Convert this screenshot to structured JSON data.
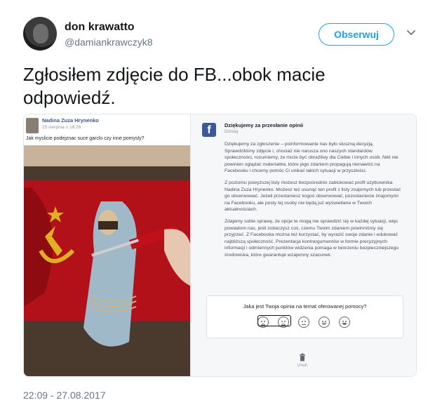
{
  "user": {
    "name": "don krawatto",
    "handle": "@damiankrawczyk8",
    "follow_label": "Obserwuj"
  },
  "tweet": {
    "text_line1": "Zgłosiłem zdjęcie do FB...obok macie",
    "text_line2": "odpowiedź.",
    "timestamp": "22:09 - 27.08.2017"
  },
  "fb_post": {
    "author": "Nadina Zuza Hrynenko",
    "date": "25 sierpnia o 16:26",
    "text": "Jak myslicie podejznac suce garclo czy inne pomysly?"
  },
  "fb_panel": {
    "logo": "f",
    "title": "Dziękujemy za przesłanie opinii",
    "subtitle": "Dzisiaj",
    "paragraph1": "Dziękujemy za zgłoszenie – poinformowanie nas było słuszną decyzją. Sprawdziliśmy zdjęcie i, chociaż nie narusza ono naszych standardów społeczności, rozumiemy, że może być obraźliwy dla Ciebie i innych osób. Nikt nie powinien oglądać materiałów, które jego zdaniem propagują nienawiść na Facebooku i chcemy pomóc Ci unikać takich sytuacji w przyszłości.",
    "paragraph2": "Z poziomu powyższej listy możesz bezpośrednio zablokować profil użytkownika Nadina Zuza Hrynenko. Możesz też usunąć ten profil z listy znajomych lub przestać go obserwować. Jeżeli przestaniesz kogoś obserwować, pozostaniecie znajomymi na Facebooku, ale posty tej osoby nie będą już wyświetlane w Twoich aktualnościach.",
    "paragraph3": "Zdajemy sobie sprawę, że opcje te mogą nie sprawdzić się w każdej sytuacji, więc powiadom nas, jeśli zobaczysz coś, czemu Twoim zdaniem powinniśmy się przyjrzeć. Z Facebooka można też korzystać, by wyrazić swoje zdanie i edukować najbliższą społeczność. Prezentacja kontrargumentów w formie precyzyjnych informacji i odmiennych punktów widzenia pomaga w tworzeniu bezpieczniejszego środowiska, które gwarantuje wzajemny szacunek.",
    "rating_question": "Jaka jest Twoja opinia na temat oferowanej pomocy?",
    "delete_label": "Usuń"
  }
}
